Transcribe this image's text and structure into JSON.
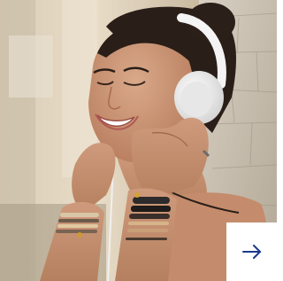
{
  "photo": {
    "subject": "woman-with-headphones",
    "icon": "photo-image"
  },
  "next_button": {
    "icon": "arrow-right-icon",
    "accent_color": "#1b3a8c"
  }
}
